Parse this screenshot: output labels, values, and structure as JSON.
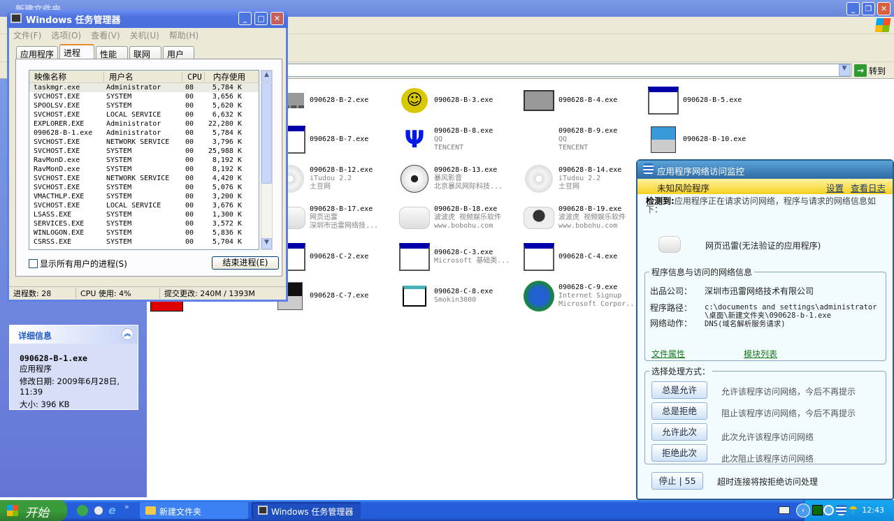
{
  "explorer": {
    "title": "新建文件夹",
    "go_label": "转到",
    "details": {
      "header": "详细信息",
      "file_name": "090628-B-1.exe",
      "file_type": "应用程序",
      "modified": "修改日期: 2009年6月28日, 11:39",
      "size": "大小: 396 KB"
    },
    "files": [
      [
        null,
        {
          "name": "090628-B-2.exe",
          "icon": "chip"
        },
        {
          "name": "090628-B-3.exe",
          "icon": "smiley"
        },
        {
          "name": "090628-B-4.exe",
          "icon": "disk-drive"
        },
        {
          "name": "090628-B-5.exe",
          "icon": "window"
        }
      ],
      [
        null,
        {
          "name": "090628-B-7.exe",
          "icon": "window"
        },
        {
          "name": "090628-B-8.exe",
          "sub1": "QQ",
          "sub2": "TENCENT",
          "icon": "realtek-crab"
        },
        {
          "name": "090628-B-9.exe",
          "sub1": "QQ",
          "sub2": "TENCENT",
          "icon": "blank"
        },
        {
          "name": "090628-B-10.exe",
          "icon": "installer"
        }
      ],
      [
        null,
        {
          "name": "090628-B-12.exe",
          "sub1": "iTudou 2.2",
          "sub2": "土豆网",
          "icon": "disc"
        },
        {
          "name": "090628-B-13.exe",
          "sub1": "暴风影音",
          "sub2": "北京暴风网际科技...",
          "icon": "soccer-ball"
        },
        {
          "name": "090628-B-14.exe",
          "sub1": "iTudou 2.2",
          "sub2": "土豆网",
          "icon": "disc"
        },
        null
      ],
      [
        null,
        {
          "name": "090628-B-17.exe",
          "sub1": "网页迅雷",
          "sub2": "深圳市迅雷网络技...",
          "icon": "white-box"
        },
        {
          "name": "090628-B-18.exe",
          "sub1": "波波虎 视频娱乐软件",
          "sub2": "www.bobohu.com",
          "icon": "white-box"
        },
        {
          "name": "090628-B-19.exe",
          "sub1": "波波虎 视频娱乐软件",
          "sub2": "www.bobohu.com",
          "icon": "globe-box"
        },
        null
      ],
      [
        null,
        {
          "name": "090628-C-2.exe",
          "icon": "window"
        },
        {
          "name": "090628-C-3.exe",
          "sub1": "Microsoft 基础类...",
          "icon": "window"
        },
        {
          "name": "090628-C-4.exe",
          "icon": "window"
        },
        null
      ],
      [
        null,
        {
          "name": "090628-C-7.exe",
          "icon": "computer-cd"
        },
        {
          "name": "090628-C-8.exe",
          "sub1": "Smokin3000",
          "icon": "folder-page"
        },
        {
          "name": "090628-C-9.exe",
          "sub1": "Internet Signup",
          "sub2": "Microsoft Corpor...",
          "icon": "globe-computer"
        },
        null
      ]
    ]
  },
  "task_manager": {
    "title": "Windows 任务管理器",
    "menu": [
      "文件(F)",
      "选项(O)",
      "查看(V)",
      "关机(U)",
      "帮助(H)"
    ],
    "tabs": [
      "应用程序",
      "进程",
      "性能",
      "联网",
      "用户"
    ],
    "active_tab": "进程",
    "columns": [
      "映像名称",
      "用户名",
      "CPU",
      "内存使用"
    ],
    "processes": [
      [
        "taskmgr.exe",
        "Administrator",
        "08",
        "5,784 K"
      ],
      [
        "SVCHOST.EXE",
        "SYSTEM",
        "00",
        "3,656 K"
      ],
      [
        "SPOOLSV.EXE",
        "SYSTEM",
        "00",
        "5,620 K"
      ],
      [
        "SVCHOST.EXE",
        "LOCAL SERVICE",
        "00",
        "6,632 K"
      ],
      [
        "EXPLORER.EXE",
        "Administrator",
        "00",
        "22,280 K"
      ],
      [
        "090628-B-1.exe",
        "Administrator",
        "00",
        "5,784 K"
      ],
      [
        "SVCHOST.EXE",
        "NETWORK SERVICE",
        "00",
        "3,796 K"
      ],
      [
        "SVCHOST.EXE",
        "SYSTEM",
        "00",
        "25,988 K"
      ],
      [
        "RavMonD.exe",
        "SYSTEM",
        "00",
        "8,192 K"
      ],
      [
        "RavMonD.exe",
        "SYSTEM",
        "00",
        "8,192 K"
      ],
      [
        "SVCHOST.EXE",
        "NETWORK SERVICE",
        "00",
        "4,420 K"
      ],
      [
        "SVCHOST.EXE",
        "SYSTEM",
        "00",
        "5,076 K"
      ],
      [
        "VMACTHLP.EXE",
        "SYSTEM",
        "00",
        "3,200 K"
      ],
      [
        "SVCHOST.EXE",
        "LOCAL SERVICE",
        "00",
        "3,676 K"
      ],
      [
        "LSASS.EXE",
        "SYSTEM",
        "00",
        "1,300 K"
      ],
      [
        "SERVICES.EXE",
        "SYSTEM",
        "00",
        "3,572 K"
      ],
      [
        "WINLOGON.EXE",
        "SYSTEM",
        "00",
        "5,836 K"
      ],
      [
        "CSRSS.EXE",
        "SYSTEM",
        "00",
        "5,704 K"
      ]
    ],
    "show_all_label": "显示所有用户的进程(S)",
    "end_process_label": "结束进程(E)",
    "status": {
      "processes": "进程数: 28",
      "cpu": "CPU 使用: 4%",
      "commit": "提交更改: 240M / 1393M"
    }
  },
  "monitor": {
    "title": "应用程序网络访问监控",
    "risk_label": "未知风险程序",
    "settings_link": "设置",
    "log_link": "查看日志",
    "detected_label": "检测到:",
    "detected_text": "应用程序正在请求访问网络，程序与请求的网络信息如下：",
    "app_name": "网页迅雷(无法验证的应用程序)",
    "info_legend": "程序信息与访问的网络信息",
    "publisher_label": "出品公司：",
    "publisher": "深圳市迅雷网络技术有限公司",
    "path_label": "程序路径：",
    "path": "c:\\documents and settings\\administrator\\桌面\\新建文件夹\\090628-b-1.exe",
    "action_label": "网络动作：",
    "action": "DNS(域名解析服务请求)",
    "file_props_link": "文件属性",
    "modules_link": "模块列表",
    "choice_legend": "选择处理方式：",
    "options": [
      {
        "button": "总是允许",
        "desc": "允许该程序访问网络，今后不再提示"
      },
      {
        "button": "总是拒绝",
        "desc": "阻止该程序访问网络，今后不再提示"
      },
      {
        "button": "允许此次",
        "desc": "此次允许该程序访问网络"
      },
      {
        "button": "拒绝此次",
        "desc": "此次阻止该程序访问网络"
      }
    ],
    "stop_label": "停止",
    "countdown": "55",
    "timeout_text": "超时连接将按拒绝访问处理"
  },
  "taskbar": {
    "start_label": "开始",
    "buttons": [
      "新建文件夹",
      "Windows 任务管理器"
    ],
    "clock": "12:43"
  }
}
